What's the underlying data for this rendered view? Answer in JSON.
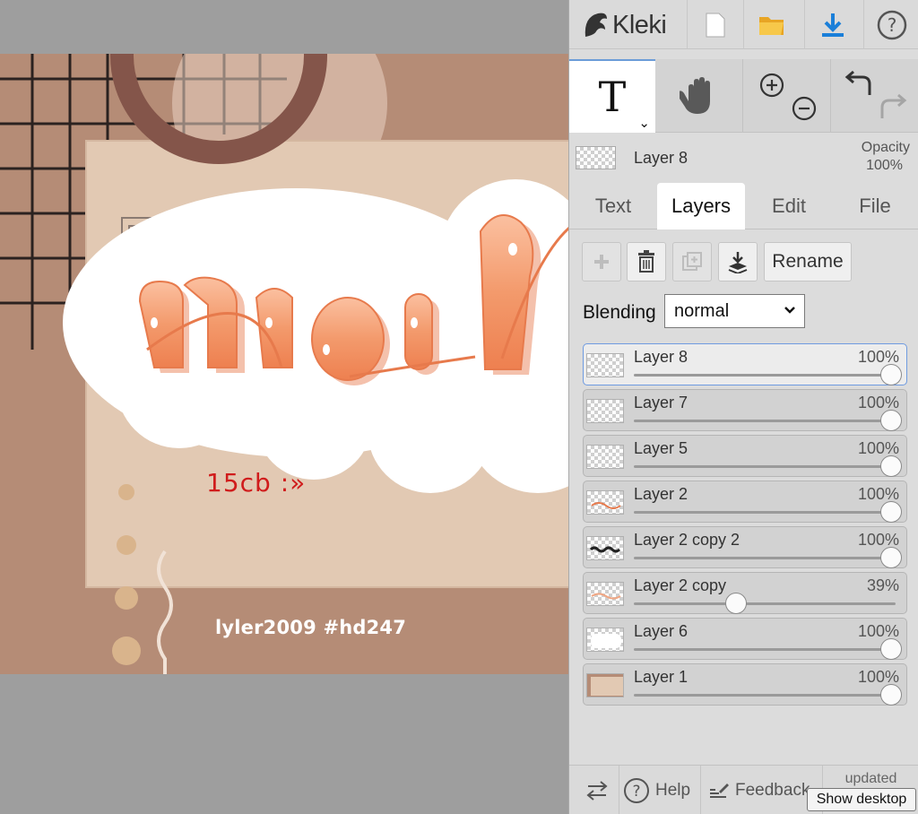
{
  "artwork": {
    "headline_text": "noel",
    "handle_text": "15cb :»",
    "credit_text": "lyler2009   #hd247",
    "colors": {
      "background": "#b58c76",
      "card": "#e2c9b3",
      "ring": "#84554a",
      "letters": "#f0905f",
      "handle": "#d01c1c"
    }
  },
  "header": {
    "brand": "Kleki",
    "icons": [
      "kleki-logo-icon",
      "new-file-icon",
      "open-folder-icon",
      "download-icon",
      "help-icon"
    ]
  },
  "tools": {
    "text_tool": "T",
    "icons": [
      "text-tool-icon",
      "hand-tool-icon",
      "zoom-icon",
      "undo-icon",
      "redo-icon"
    ]
  },
  "current_layer": {
    "name": "Layer 8",
    "opacity_label": "Opacity",
    "opacity_value": "100%"
  },
  "tabs": [
    {
      "label": "Text",
      "active": false
    },
    {
      "label": "Layers",
      "active": true
    },
    {
      "label": "Edit",
      "active": false
    },
    {
      "label": "File",
      "active": false
    }
  ],
  "layer_actions": {
    "icons": [
      "add-layer-icon",
      "delete-layer-icon",
      "duplicate-layer-icon",
      "merge-down-icon"
    ],
    "rename_label": "Rename"
  },
  "blending": {
    "label": "Blending",
    "value": "normal"
  },
  "layers": [
    {
      "name": "Layer 8",
      "opacity_text": "100%",
      "opacity": 100,
      "selected": true
    },
    {
      "name": "Layer 7",
      "opacity_text": "100%",
      "opacity": 100,
      "selected": false
    },
    {
      "name": "Layer 5",
      "opacity_text": "100%",
      "opacity": 100,
      "selected": false
    },
    {
      "name": "Layer 2",
      "opacity_text": "100%",
      "opacity": 100,
      "selected": false
    },
    {
      "name": "Layer 2 copy 2",
      "opacity_text": "100%",
      "opacity": 100,
      "selected": false
    },
    {
      "name": "Layer 2 copy",
      "opacity_text": "39%",
      "opacity": 39,
      "selected": false
    },
    {
      "name": "Layer 6",
      "opacity_text": "100%",
      "opacity": 100,
      "selected": false
    },
    {
      "name": "Layer 1",
      "opacity_text": "100%",
      "opacity": 100,
      "selected": false
    }
  ],
  "footer": {
    "help_label": "Help",
    "feedback_label": "Feedback",
    "updated_label": "updated",
    "tooltip": "Show desktop"
  }
}
